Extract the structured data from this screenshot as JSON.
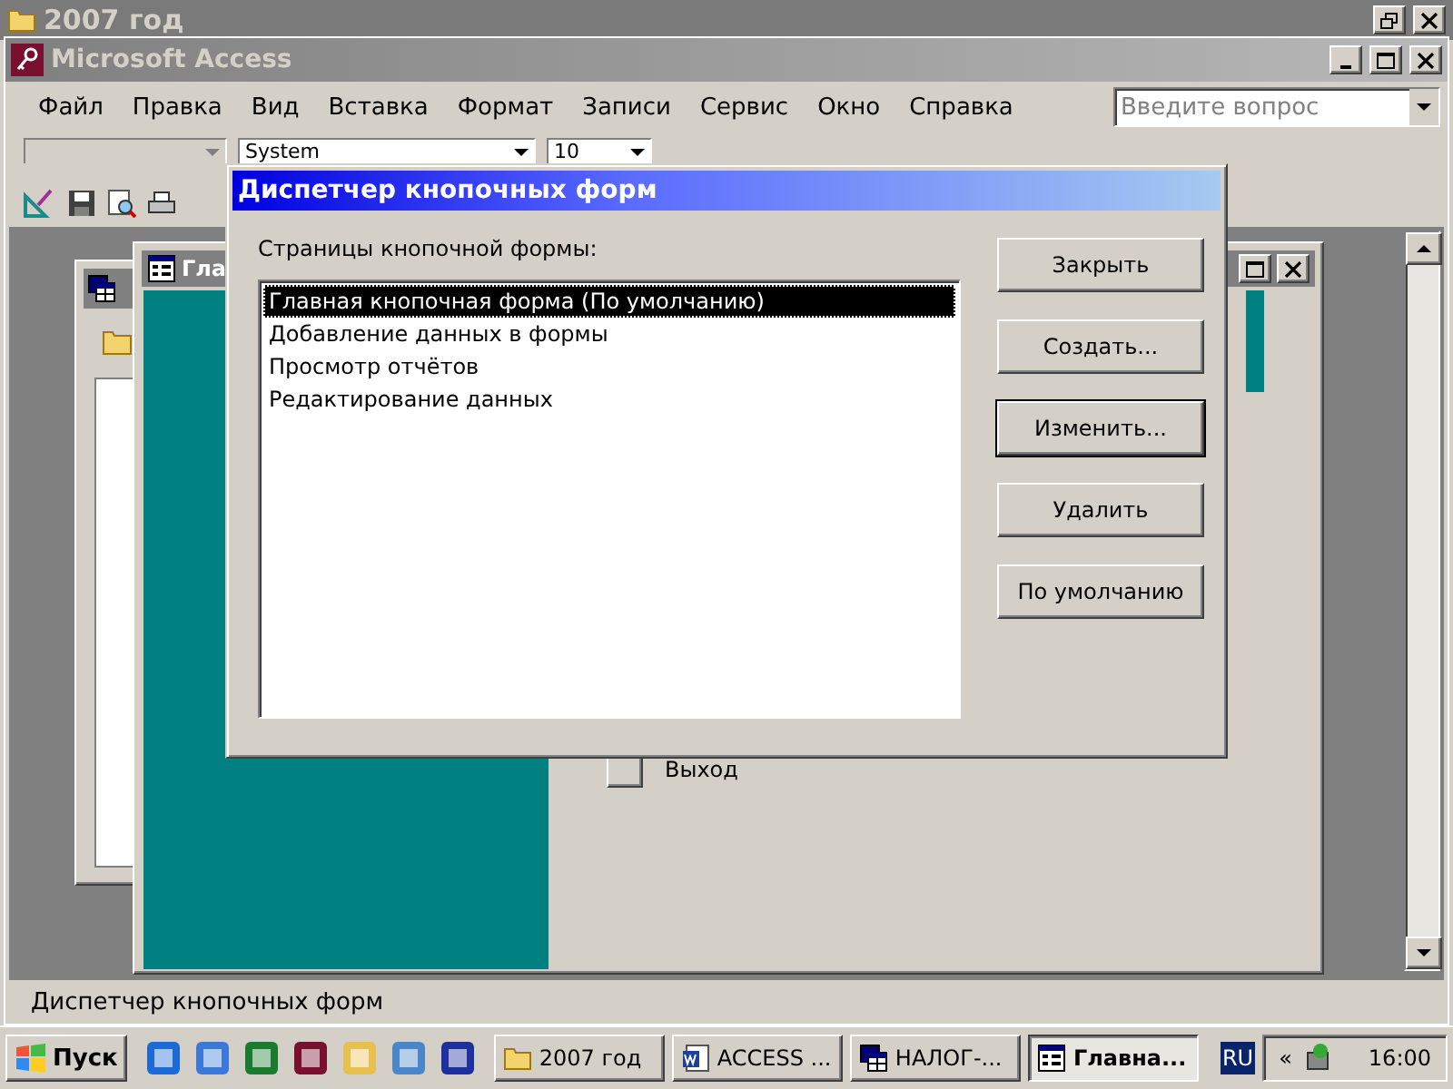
{
  "background_window": {
    "title": "2007 год"
  },
  "window": {
    "title": "Microsoft Access"
  },
  "menu": [
    "Файл",
    "Правка",
    "Вид",
    "Вставка",
    "Формат",
    "Записи",
    "Сервис",
    "Окно",
    "Справка"
  ],
  "help_box": {
    "placeholder": "Введите вопрос"
  },
  "toolbar": {
    "font": "System",
    "size": "10"
  },
  "form_window": {
    "title": "Гла",
    "button_label": "Выход"
  },
  "dialog": {
    "title": "Диспетчер кнопочных форм",
    "list_label": "Страницы кнопочной формы:",
    "pages": [
      {
        "label": "Главная кнопочная форма (По умолчанию)",
        "selected": true
      },
      {
        "label": "Добавление данных в формы",
        "selected": false
      },
      {
        "label": "Просмотр отчётов",
        "selected": false
      },
      {
        "label": "Редактирование данных",
        "selected": false
      }
    ],
    "buttons": [
      {
        "label": "Закрыть",
        "default": false
      },
      {
        "label": "Создать...",
        "default": false
      },
      {
        "label": "Изменить...",
        "default": true
      },
      {
        "label": "Удалить",
        "default": false
      },
      {
        "label": "По умолчанию",
        "default": false
      }
    ]
  },
  "status_bar": {
    "text": "Диспетчер кнопочных форм"
  },
  "taskbar": {
    "start": "Пуск",
    "tasks": [
      {
        "label": "2007 год",
        "kind": "folder",
        "selected": false
      },
      {
        "label": "ACCESS ...",
        "kind": "word",
        "selected": false
      },
      {
        "label": "НАЛОГ-...",
        "kind": "database",
        "selected": false
      },
      {
        "label": "Главна...",
        "kind": "form",
        "selected": true
      }
    ],
    "language": "RU",
    "tray_toggle": "«",
    "clock": "16:00"
  }
}
